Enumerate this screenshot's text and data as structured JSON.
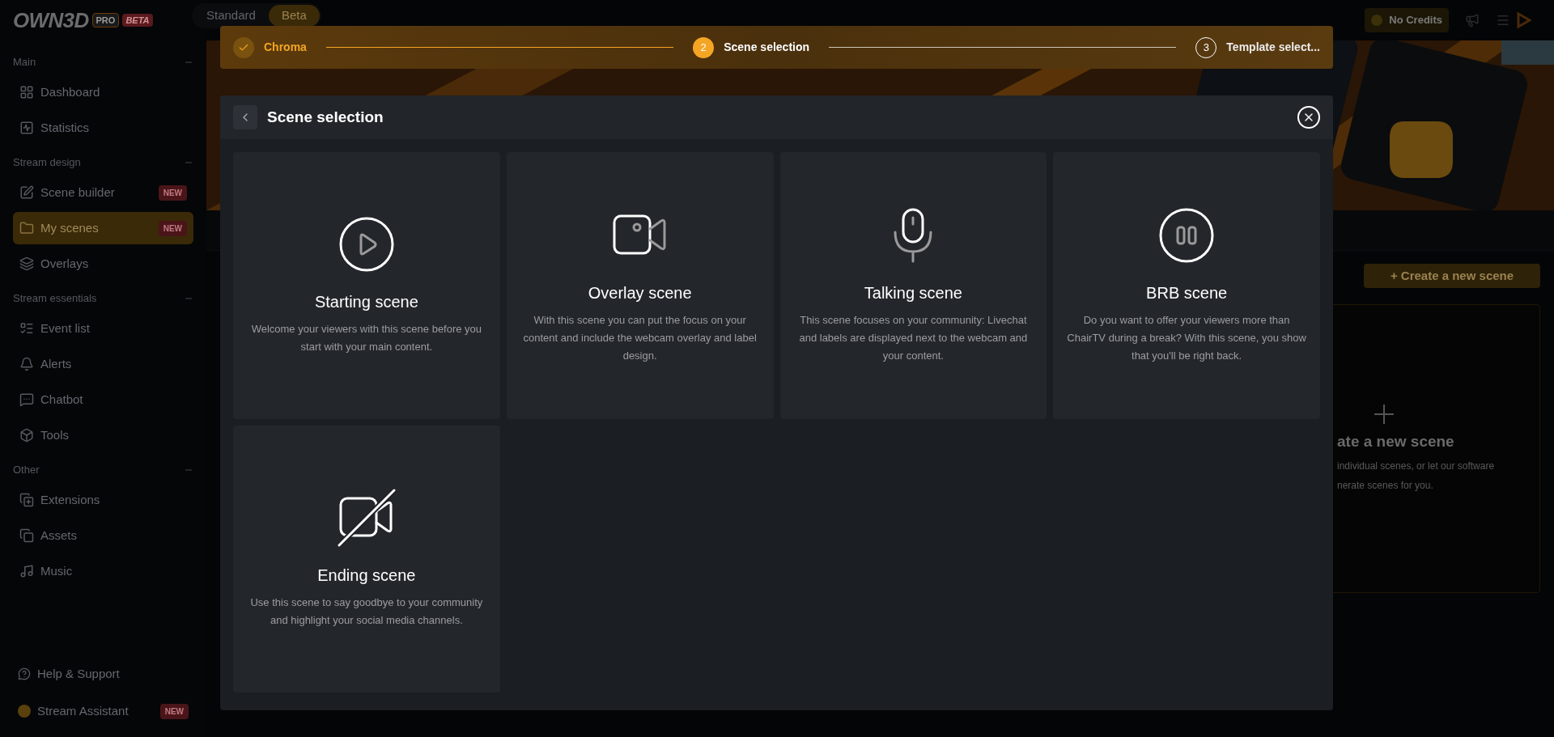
{
  "logo": {
    "name": "OWN3D",
    "tier": "PRO",
    "badge": "BETA"
  },
  "mode_tabs": [
    {
      "label": "Standard",
      "selected": false
    },
    {
      "label": "Beta",
      "selected": true
    }
  ],
  "topbar": {
    "credits": "No Credits"
  },
  "sidebar": {
    "sections": [
      {
        "title": "Main",
        "items": [
          {
            "label": "Dashboard",
            "selected": false
          },
          {
            "label": "Statistics",
            "selected": false
          }
        ]
      },
      {
        "title": "Stream design",
        "items": [
          {
            "label": "Scene builder",
            "badge": "NEW",
            "selected": false
          },
          {
            "label": "My scenes",
            "badge": "NEW",
            "selected": true
          },
          {
            "label": "Overlays",
            "selected": false
          }
        ]
      },
      {
        "title": "Stream essentials",
        "items": [
          {
            "label": "Event list",
            "selected": false
          },
          {
            "label": "Alerts",
            "selected": false
          },
          {
            "label": "Chatbot",
            "selected": false
          },
          {
            "label": "Tools",
            "selected": false
          }
        ]
      },
      {
        "title": "Other",
        "items": [
          {
            "label": "Extensions",
            "selected": false
          },
          {
            "label": "Assets",
            "selected": false
          },
          {
            "label": "Music",
            "selected": false
          }
        ]
      }
    ],
    "footer": [
      {
        "label": "Help & Support"
      },
      {
        "label": "Stream Assistant",
        "badge": "NEW"
      }
    ]
  },
  "page": {
    "create_button": "+ Create a new scene",
    "create_card": {
      "title": "ate a new scene",
      "lines": [
        "individual scenes, or let our software",
        "nerate scenes for you."
      ]
    }
  },
  "stepper": [
    {
      "label": "Chroma",
      "completed": true,
      "selected": false
    },
    {
      "number": "2",
      "label": "Scene selection",
      "completed": false,
      "selected": true
    },
    {
      "number": "3",
      "label": "Template select...",
      "completed": false,
      "selected": false
    }
  ],
  "dialog": {
    "title": "Scene selection",
    "scenes": [
      {
        "kind": "start",
        "title": "Starting scene",
        "description": "Welcome your viewers with this scene before you start with your main content."
      },
      {
        "kind": "overlay",
        "title": "Overlay scene",
        "description": "With this scene you can put the focus on your content and include the webcam overlay and label design."
      },
      {
        "kind": "talking",
        "title": "Talking scene",
        "description": "This scene focuses on your community: Livechat and labels are displayed next to the webcam and your content."
      },
      {
        "kind": "brb",
        "title": "BRB scene",
        "description": "Do you want to offer your viewers more than ChairTV during a break? With this scene, you show that you'll be right back."
      },
      {
        "kind": "ending",
        "title": "Ending scene",
        "description": "Use this scene to say goodbye to your community and highlight your social media channels."
      }
    ]
  }
}
